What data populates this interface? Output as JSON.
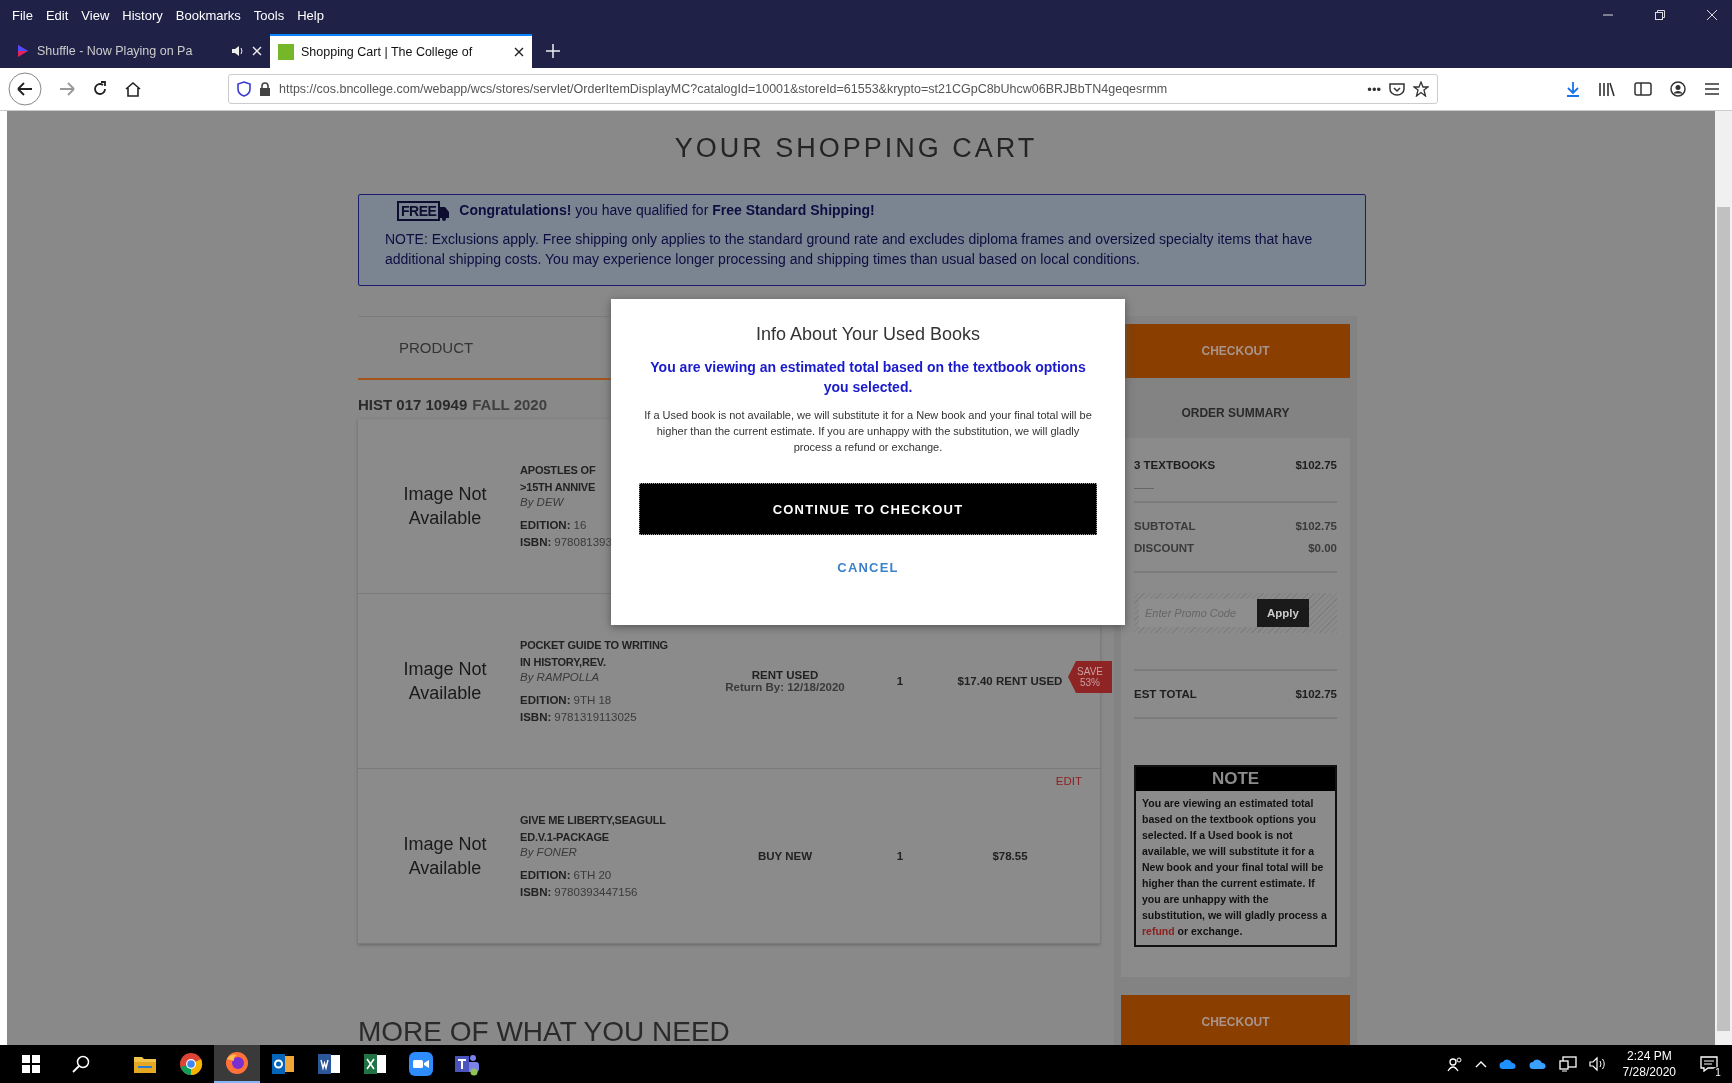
{
  "menu_bar": [
    "File",
    "Edit",
    "View",
    "History",
    "Bookmarks",
    "Tools",
    "Help"
  ],
  "tabs": [
    {
      "title": "Shuffle - Now Playing on Pa",
      "selected": false,
      "audio": true
    },
    {
      "title": "Shopping Cart | The College of",
      "selected": true,
      "audio": false
    }
  ],
  "address_bar": {
    "url": "https://cos.bncollege.com/webapp/wcs/stores/servlet/OrderItemDisplayMC?catalogId=10001&storeId=61553&krypto=st21CGpC8bUhcw06BRJBbTN4geqesrmm",
    "more": "•••"
  },
  "page_title": "YOUR SHOPPING CART",
  "shipping_banner": {
    "badge": "FREE",
    "headline": "**Congratulations!** you have qualified for **Free Standard Shipping!**",
    "note": "NOTE: Exclusions apply. Free shipping only applies to the standard ground rate and excludes diploma frames and oversized specialty items that have additional shipping costs. You may experience longer processing and shipping times than usual based on local conditions."
  },
  "cart": {
    "column_header": "PRODUCT",
    "course": "HIST 017 10949",
    "term": "FALL 2020",
    "items": [
      {
        "image_text": "Image Not Available",
        "title_lines": [
          "APOSTLES OF",
          ">15TH ANNIVE"
        ],
        "author": "By DEW",
        "edition_label": "EDITION:",
        "edition": "16",
        "isbn_label": "ISBN:",
        "isbn": "978081393"
      },
      {
        "image_text": "Image Not Available",
        "title_lines": [
          "POCKET GUIDE TO WRITING",
          "IN HISTORY,REV."
        ],
        "author": "By RAMPOLLA",
        "edition_label": "EDITION:",
        "edition": "9TH 18",
        "isbn_label": "ISBN:",
        "isbn": "9781319113025",
        "format": "RENT USED",
        "return_by": "Return By: 12/18/2020",
        "qty": "1",
        "price": "$17.40 RENT USED",
        "save": {
          "label": "SAVE",
          "percent": "53%"
        }
      },
      {
        "image_text": "Image Not Available",
        "title_lines": [
          "GIVE ME LIBERTY,SEAGULL",
          "ED.V.1-PACKAGE"
        ],
        "author": "By FONER",
        "edition_label": "EDITION:",
        "edition": "6TH 20",
        "isbn_label": "ISBN:",
        "isbn": "9780393447156",
        "format": "BUY NEW",
        "qty": "1",
        "price": "$78.55",
        "edit": "EDIT"
      }
    ]
  },
  "more_heading": "MORE OF WHAT YOU NEED",
  "summary": {
    "checkout_top": "CHECKOUT",
    "title": "ORDER SUMMARY",
    "textbooks_label": "3 TEXTBOOKS",
    "textbooks_value": "$102.75",
    "rows": [
      {
        "label": "SUBTOTAL",
        "value": "$102.75"
      },
      {
        "label": "DISCOUNT",
        "value": "$0.00"
      }
    ],
    "promo_placeholder": "Enter Promo Code",
    "apply": "Apply",
    "total_label": "EST TOTAL",
    "total_value": "$102.75",
    "note_title": "NOTE",
    "note_before": "You are viewing an estimated total based on the textbook options you selected. If a Used book is not available, we will substitute it for a New book and your final total will be higher than the current estimate. If you are unhappy with the substitution, we will gladly process a ",
    "note_link": "refund",
    "note_after": " or exchange.",
    "checkout_bottom": "CHECKOUT"
  },
  "modal": {
    "title": "Info About Your Used Books",
    "lead": "You are viewing an estimated total based on the textbook options you selected.",
    "body": "If a Used book is not available, we will substitute it for a New book and your final total will be higher than the current estimate. If you are unhappy with the substitution, we will gladly process a refund or exchange.",
    "primary": "CONTINUE TO CHECKOUT",
    "cancel": "CANCEL"
  },
  "taskbar": {
    "time": "2:24 PM",
    "date": "7/28/2020",
    "notifications": "1"
  }
}
